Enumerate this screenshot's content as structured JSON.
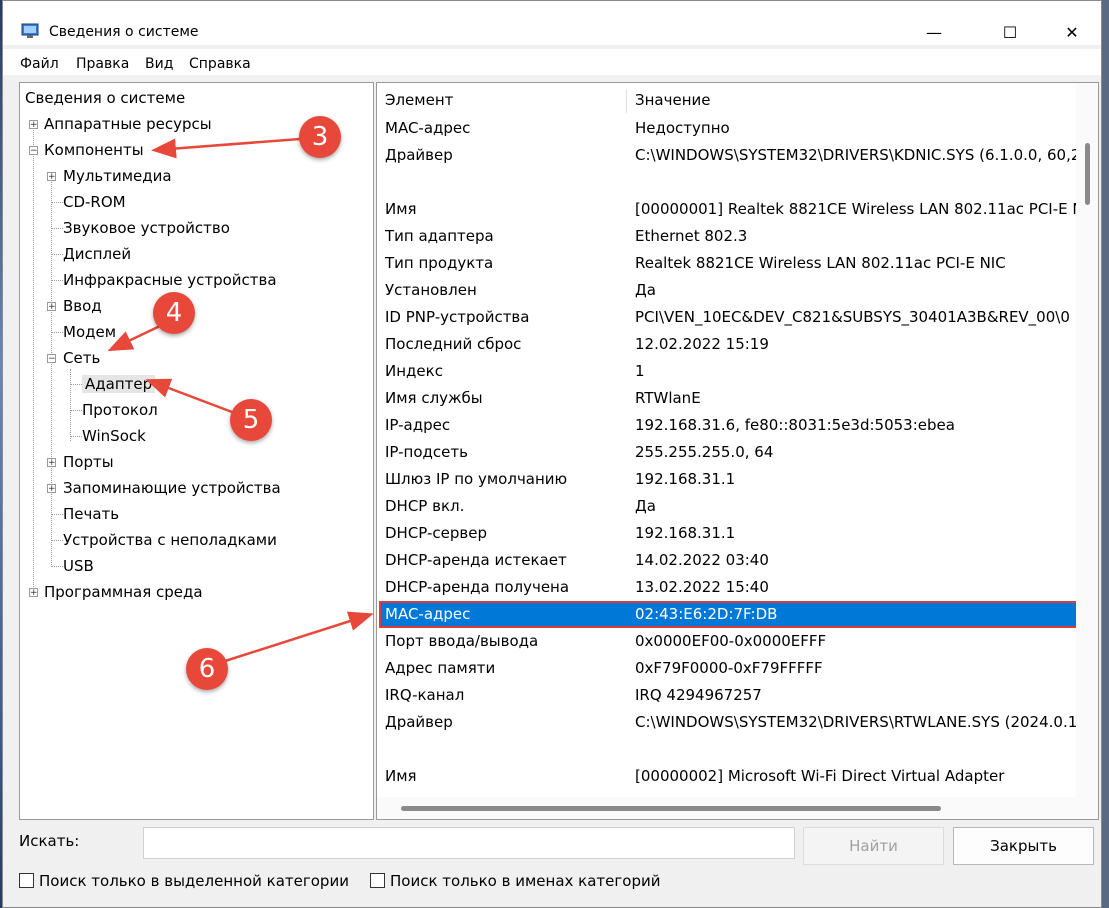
{
  "window": {
    "title": "Сведения о системе",
    "minimize": "—",
    "maximize": "☐",
    "close": "✕"
  },
  "menu": [
    "Файл",
    "Правка",
    "Вид",
    "Справка"
  ],
  "tree": {
    "root": "Сведения о системе",
    "items": [
      {
        "label": "Аппаратные ресурсы",
        "level": 1,
        "expander": "+"
      },
      {
        "label": "Компоненты",
        "level": 1,
        "expander": "−"
      },
      {
        "label": "Мультимедиа",
        "level": 2,
        "expander": "+"
      },
      {
        "label": "CD-ROM",
        "level": 2,
        "expander": ""
      },
      {
        "label": "Звуковое устройство",
        "level": 2,
        "expander": ""
      },
      {
        "label": "Дисплей",
        "level": 2,
        "expander": ""
      },
      {
        "label": "Инфракрасные устройства",
        "level": 2,
        "expander": ""
      },
      {
        "label": "Ввод",
        "level": 2,
        "expander": "+"
      },
      {
        "label": "Модем",
        "level": 2,
        "expander": ""
      },
      {
        "label": "Сеть",
        "level": 2,
        "expander": "−"
      },
      {
        "label": "Адаптер",
        "level": 3,
        "expander": ""
      },
      {
        "label": "Протокол",
        "level": 3,
        "expander": ""
      },
      {
        "label": "WinSock",
        "level": 3,
        "expander": ""
      },
      {
        "label": "Порты",
        "level": 2,
        "expander": "+"
      },
      {
        "label": "Запоминающие устройства",
        "level": 2,
        "expander": "+"
      },
      {
        "label": "Печать",
        "level": 2,
        "expander": ""
      },
      {
        "label": "Устройства с неполадками",
        "level": 2,
        "expander": ""
      },
      {
        "label": "USB",
        "level": 2,
        "expander": ""
      },
      {
        "label": "Программная среда",
        "level": 1,
        "expander": "+"
      }
    ]
  },
  "list": {
    "columns": [
      "Элемент",
      "Значение"
    ],
    "rows": [
      [
        "MAC-адрес",
        "Недоступно"
      ],
      [
        "Драйвер",
        "C:\\WINDOWS\\SYSTEM32\\DRIVERS\\KDNIC.SYS (6.1.0.0, 60,2"
      ],
      [
        "",
        ""
      ],
      [
        "Имя",
        "[00000001] Realtek 8821CE Wireless LAN 802.11ac PCI-E N"
      ],
      [
        "Тип адаптера",
        "Ethernet 802.3"
      ],
      [
        "Тип продукта",
        "Realtek 8821CE Wireless LAN 802.11ac PCI-E NIC"
      ],
      [
        "Установлен",
        "Да"
      ],
      [
        "ID PNP-устройства",
        "PCI\\VEN_10EC&DEV_C821&SUBSYS_30401A3B&REV_00\\0"
      ],
      [
        "Последний сброс",
        "12.02.2022 15:19"
      ],
      [
        "Индекс",
        "1"
      ],
      [
        "Имя службы",
        "RTWlanE"
      ],
      [
        "IP-адрес",
        "192.168.31.6, fe80::8031:5e3d:5053:ebea"
      ],
      [
        "IP-подсеть",
        "255.255.255.0, 64"
      ],
      [
        "Шлюз IP по умолчанию",
        "192.168.31.1"
      ],
      [
        "DHCP вкл.",
        "Да"
      ],
      [
        "DHCP-сервер",
        "192.168.31.1"
      ],
      [
        "DHCP-аренда истекает",
        "14.02.2022 03:40"
      ],
      [
        "DHCP-аренда получена",
        "13.02.2022 15:40"
      ],
      [
        "MAC-адрес",
        "02:43:E6:2D:7F:DB"
      ],
      [
        "Порт ввода/вывода",
        "0x0000EF00-0x0000EFFF"
      ],
      [
        "Адрес памяти",
        "0xF79F0000-0xF79FFFFF"
      ],
      [
        "IRQ-канал",
        "IRQ 4294967257"
      ],
      [
        "Драйвер",
        "C:\\WINDOWS\\SYSTEM32\\DRIVERS\\RTWLANE.SYS (2024.0.1"
      ],
      [
        "",
        ""
      ],
      [
        "Имя",
        "[00000002] Microsoft Wi-Fi Direct Virtual Adapter"
      ]
    ],
    "selected_row": 18
  },
  "search": {
    "label": "Искать:",
    "value": "",
    "find_button": "Найти",
    "close_button": "Закрыть"
  },
  "checkboxes": [
    {
      "label": "Поиск только в выделенной категории",
      "checked": false
    },
    {
      "label": "Поиск только в именах категорий",
      "checked": false
    }
  ],
  "annotations": [
    "3",
    "4",
    "5",
    "6"
  ],
  "colors": {
    "selection": "#0078d7",
    "annotation": "#e8483a"
  }
}
